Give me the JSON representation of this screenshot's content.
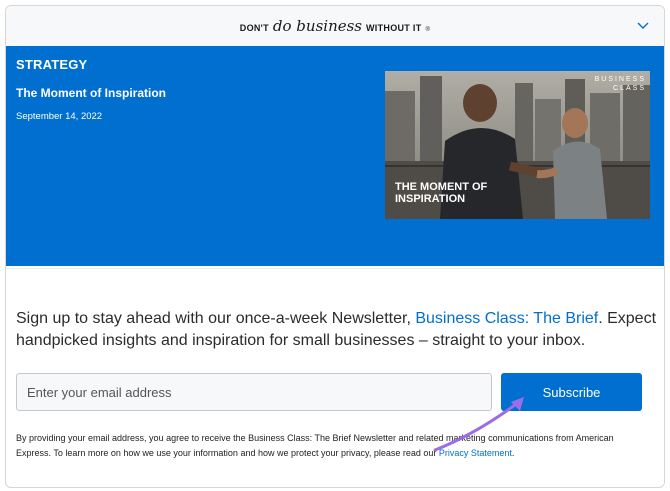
{
  "header": {
    "tagline_left": "DON'T",
    "tagline_script": "do business",
    "tagline_right": "WITHOUT IT",
    "tagline_mark": "®"
  },
  "hero": {
    "eyebrow": "STRATEGY",
    "title": "The Moment of Inspiration",
    "date": "September 14, 2022",
    "image": {
      "brand": "BUSINESS CLASS",
      "caption": "THE MOMENT OF INSPIRATION"
    }
  },
  "signup": {
    "text_before": "Sign up to stay ahead with our once-a-week Newsletter, ",
    "link": "Business Class: The Brief",
    "text_after": ". Expect handpicked insights and inspiration for small businesses – straight to your inbox.",
    "email_placeholder": "Enter your email address",
    "email_value": "",
    "subscribe_label": "Subscribe",
    "disclaimer_text": "By providing your email address, you agree to receive the Business Class: The Brief Newsletter and related marketing communications from American Express. To learn more on how we use your information and how we protect your privacy, please read our ",
    "disclaimer_link": "Privacy Statement",
    "disclaimer_end": "."
  },
  "colors": {
    "brand_blue": "#006fcf",
    "annotation_arrow": "#9b6ee8"
  },
  "icons": {
    "collapse": "chevron-down-icon",
    "annotation": "pointer-arrow-icon"
  }
}
